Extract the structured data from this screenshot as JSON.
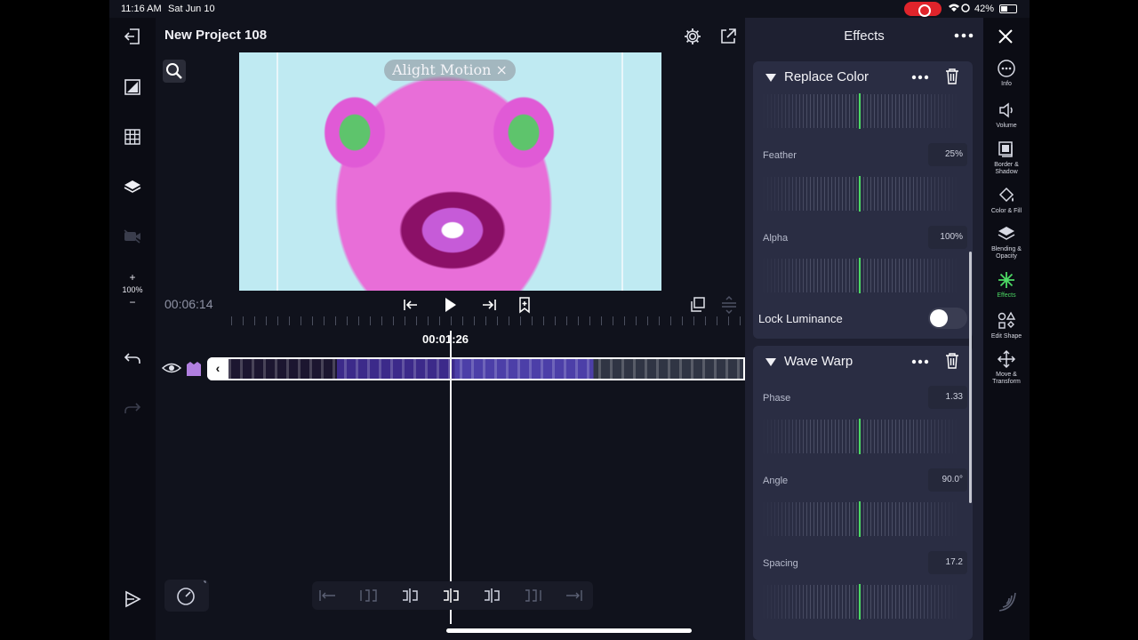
{
  "status_bar": {
    "time": "11:16 AM",
    "date": "Sat Jun 10",
    "battery": "42%"
  },
  "project": {
    "title": "New Project 108"
  },
  "left_rail": {
    "zoom_plus": "+",
    "zoom_level": "100%",
    "zoom_minus": "−"
  },
  "preview": {
    "watermark": "Alight Motion ×"
  },
  "timeline": {
    "current_time": "00:06:14",
    "playhead_time": "00:01:26"
  },
  "effects_panel": {
    "title": "Effects",
    "effects": [
      {
        "name": "Replace Color",
        "params": [
          {
            "label": "Feather",
            "value": "25%"
          },
          {
            "label": "Alpha",
            "value": "100%"
          }
        ],
        "toggle_label": "Lock Luminance"
      },
      {
        "name": "Wave Warp",
        "params": [
          {
            "label": "Phase",
            "value": "1.33"
          },
          {
            "label": "Angle",
            "value": "90.0°"
          },
          {
            "label": "Spacing",
            "value": "17.2"
          }
        ]
      }
    ]
  },
  "right_rail": {
    "items": [
      {
        "label": "Info",
        "icon": "info-icon"
      },
      {
        "label": "Volume",
        "icon": "volume-icon"
      },
      {
        "label": "Border & Shadow",
        "icon": "border-shadow-icon"
      },
      {
        "label": "Color & Fill",
        "icon": "color-fill-icon"
      },
      {
        "label": "Blending & Opacity",
        "icon": "blending-opacity-icon"
      },
      {
        "label": "Effects",
        "icon": "effects-icon"
      },
      {
        "label": "Edit Shape",
        "icon": "edit-shape-icon"
      },
      {
        "label": "Move & Transform",
        "icon": "move-transform-icon"
      }
    ]
  },
  "colors": {
    "accent": "#4cd964",
    "panel": "#1e2031",
    "background": "#10121c"
  }
}
